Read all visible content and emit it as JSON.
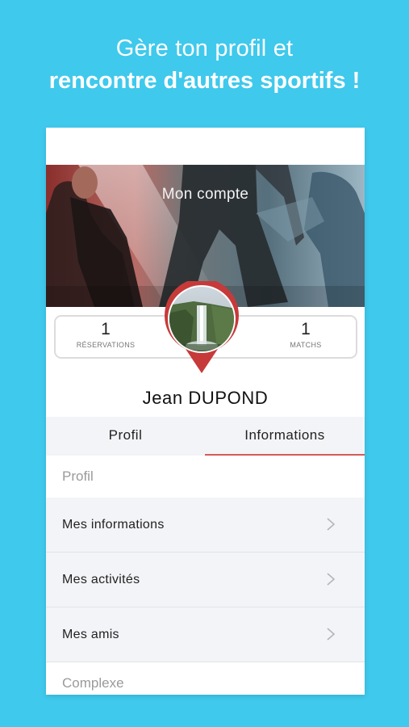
{
  "headline": {
    "line1": "Gère ton profil et",
    "line2": "rencontre d'autres sportifs !"
  },
  "hero": {
    "title": "Mon compte"
  },
  "stats": {
    "left": {
      "value": "1",
      "label": "RÉSERVATIONS"
    },
    "right": {
      "value": "1",
      "label": "MATCHS"
    }
  },
  "user": {
    "name": "Jean  DUPOND"
  },
  "tabs": [
    {
      "label": "Profil",
      "active": false
    },
    {
      "label": "Informations",
      "active": true
    }
  ],
  "sections": [
    {
      "title": "Profil",
      "items": [
        {
          "label": "Mes informations",
          "icon": "chevron-right-icon"
        },
        {
          "label": "Mes activités",
          "icon": "chevron-right-icon"
        },
        {
          "label": "Mes amis",
          "icon": "chevron-right-icon"
        }
      ]
    },
    {
      "title": "Complexe",
      "items": []
    }
  ],
  "colors": {
    "background": "#3fc9ec",
    "accent": "#c73a3a",
    "tab_underline": "#d35d57"
  }
}
